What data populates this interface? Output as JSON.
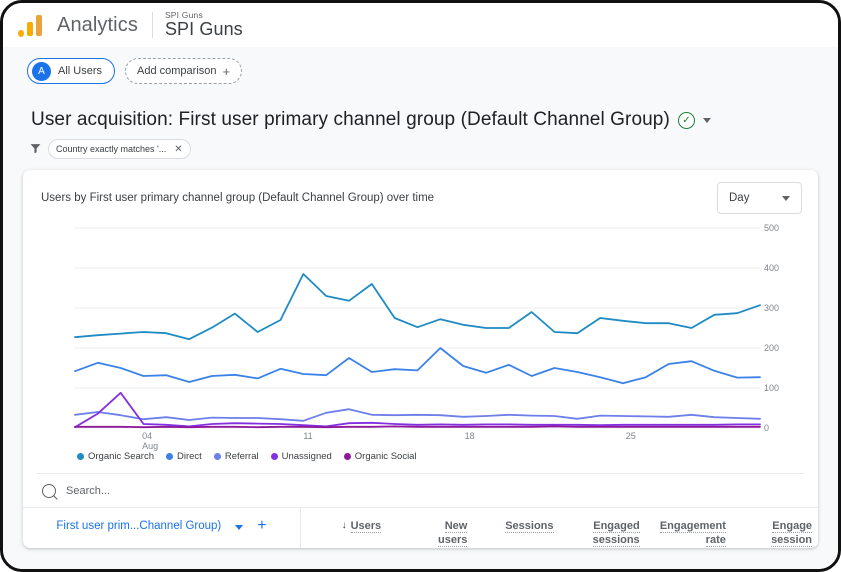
{
  "topbar": {
    "logo_icon": "analytics-logo-icon",
    "brand": "Analytics",
    "account_name": "SPI Guns",
    "property_name": "SPI Guns"
  },
  "comparison": {
    "all_users_avatar": "A",
    "all_users_label": "All Users",
    "add_comparison_label": "Add comparison",
    "add_comparison_icon": "plus-icon"
  },
  "report": {
    "title": "User acquisition: First user primary channel group (Default Channel Group)",
    "badge_icon": "check-circle-icon",
    "badge_glyph": "✓",
    "dropdown_icon": "chevron-down-icon",
    "filter_icon": "funnel-icon",
    "filter_chip_label": "Country exactly matches '...",
    "filter_remove_icon": "close-icon",
    "filter_remove_glyph": "✕"
  },
  "card": {
    "chart_title": "Users by First user primary channel group (Default Channel Group) over time",
    "granularity_value": "Day",
    "granularity_icon": "chevron-down-icon"
  },
  "search": {
    "icon": "search-icon",
    "placeholder": "Search..."
  },
  "table": {
    "dimension_label": "First user prim...Channel Group)",
    "dimension_dropdown_icon": "chevron-down-icon",
    "add_dimension_icon": "plus-icon",
    "add_dimension_glyph": "+",
    "sort_icon": "arrow-down-icon",
    "sort_glyph": "↓",
    "columns": [
      {
        "label": "Users",
        "line2": ""
      },
      {
        "label": "New",
        "line2": "users"
      },
      {
        "label": "Sessions",
        "line2": ""
      },
      {
        "label": "Engaged",
        "line2": "sessions"
      },
      {
        "label": "Engagement",
        "line2": "rate"
      },
      {
        "label": "Engage",
        "line2": "session"
      }
    ]
  },
  "colors": {
    "organic_search": "#1E8BC3",
    "direct": "#3B82E8",
    "referral": "#6D7FE8",
    "unassigned": "#8330E0",
    "organic_social": "#8E1A9B",
    "brand_orange": "#F9AB00",
    "accent_blue": "#1a73e8",
    "grid": "#ececef",
    "axis_text": "#80868b"
  },
  "chart_data": {
    "type": "line",
    "title": "Users by First user primary channel group (Default Channel Group) over time",
    "xlabel": "",
    "ylabel": "Users",
    "ylim": [
      0,
      500
    ],
    "yticks": [
      0,
      100,
      200,
      300,
      400,
      500
    ],
    "grid": true,
    "legend_position": "bottom-left",
    "x_tick_labels": [
      "04\nAug",
      "11",
      "18",
      "25"
    ],
    "x_tick_indices": [
      3,
      10,
      17,
      24
    ],
    "x": [
      1,
      2,
      3,
      4,
      5,
      6,
      7,
      8,
      9,
      10,
      11,
      12,
      13,
      14,
      15,
      16,
      17,
      18,
      19,
      20,
      21,
      22,
      23,
      24,
      25,
      26,
      27,
      28,
      29,
      30,
      31
    ],
    "series": [
      {
        "name": "Organic Search",
        "color": "#1E8BC3",
        "values": [
          227,
          232,
          236,
          240,
          237,
          222,
          251,
          286,
          240,
          270,
          385,
          330,
          318,
          360,
          275,
          252,
          272,
          258,
          250,
          250,
          290,
          240,
          237,
          275,
          268,
          262,
          262,
          250,
          283,
          287,
          307
        ]
      },
      {
        "name": "Direct",
        "color": "#3B82E8",
        "values": [
          142,
          163,
          150,
          130,
          132,
          115,
          130,
          133,
          124,
          148,
          135,
          132,
          175,
          140,
          147,
          144,
          200,
          155,
          138,
          158,
          130,
          150,
          140,
          127,
          112,
          127,
          160,
          167,
          143,
          126,
          127
        ]
      },
      {
        "name": "Referral",
        "color": "#6D7FE8",
        "values": [
          33,
          40,
          32,
          22,
          27,
          20,
          26,
          25,
          25,
          22,
          18,
          38,
          47,
          33,
          32,
          33,
          32,
          28,
          30,
          33,
          31,
          30,
          23,
          31,
          30,
          29,
          28,
          33,
          27,
          25,
          23
        ]
      },
      {
        "name": "Unassigned",
        "color": "#8330E0",
        "values": [
          2,
          36,
          88,
          10,
          8,
          4,
          10,
          12,
          11,
          10,
          7,
          4,
          12,
          13,
          10,
          8,
          9,
          8,
          9,
          9,
          8,
          8,
          8,
          7,
          8,
          8,
          8,
          8,
          8,
          9,
          9
        ]
      },
      {
        "name": "Organic Social",
        "color": "#8E1A9B",
        "values": [
          3,
          3,
          3,
          2,
          3,
          2,
          3,
          3,
          2,
          3,
          3,
          2,
          3,
          3,
          4,
          3,
          3,
          3,
          3,
          3,
          3,
          4,
          3,
          3,
          3,
          3,
          3,
          3,
          3,
          3,
          3
        ]
      }
    ]
  }
}
